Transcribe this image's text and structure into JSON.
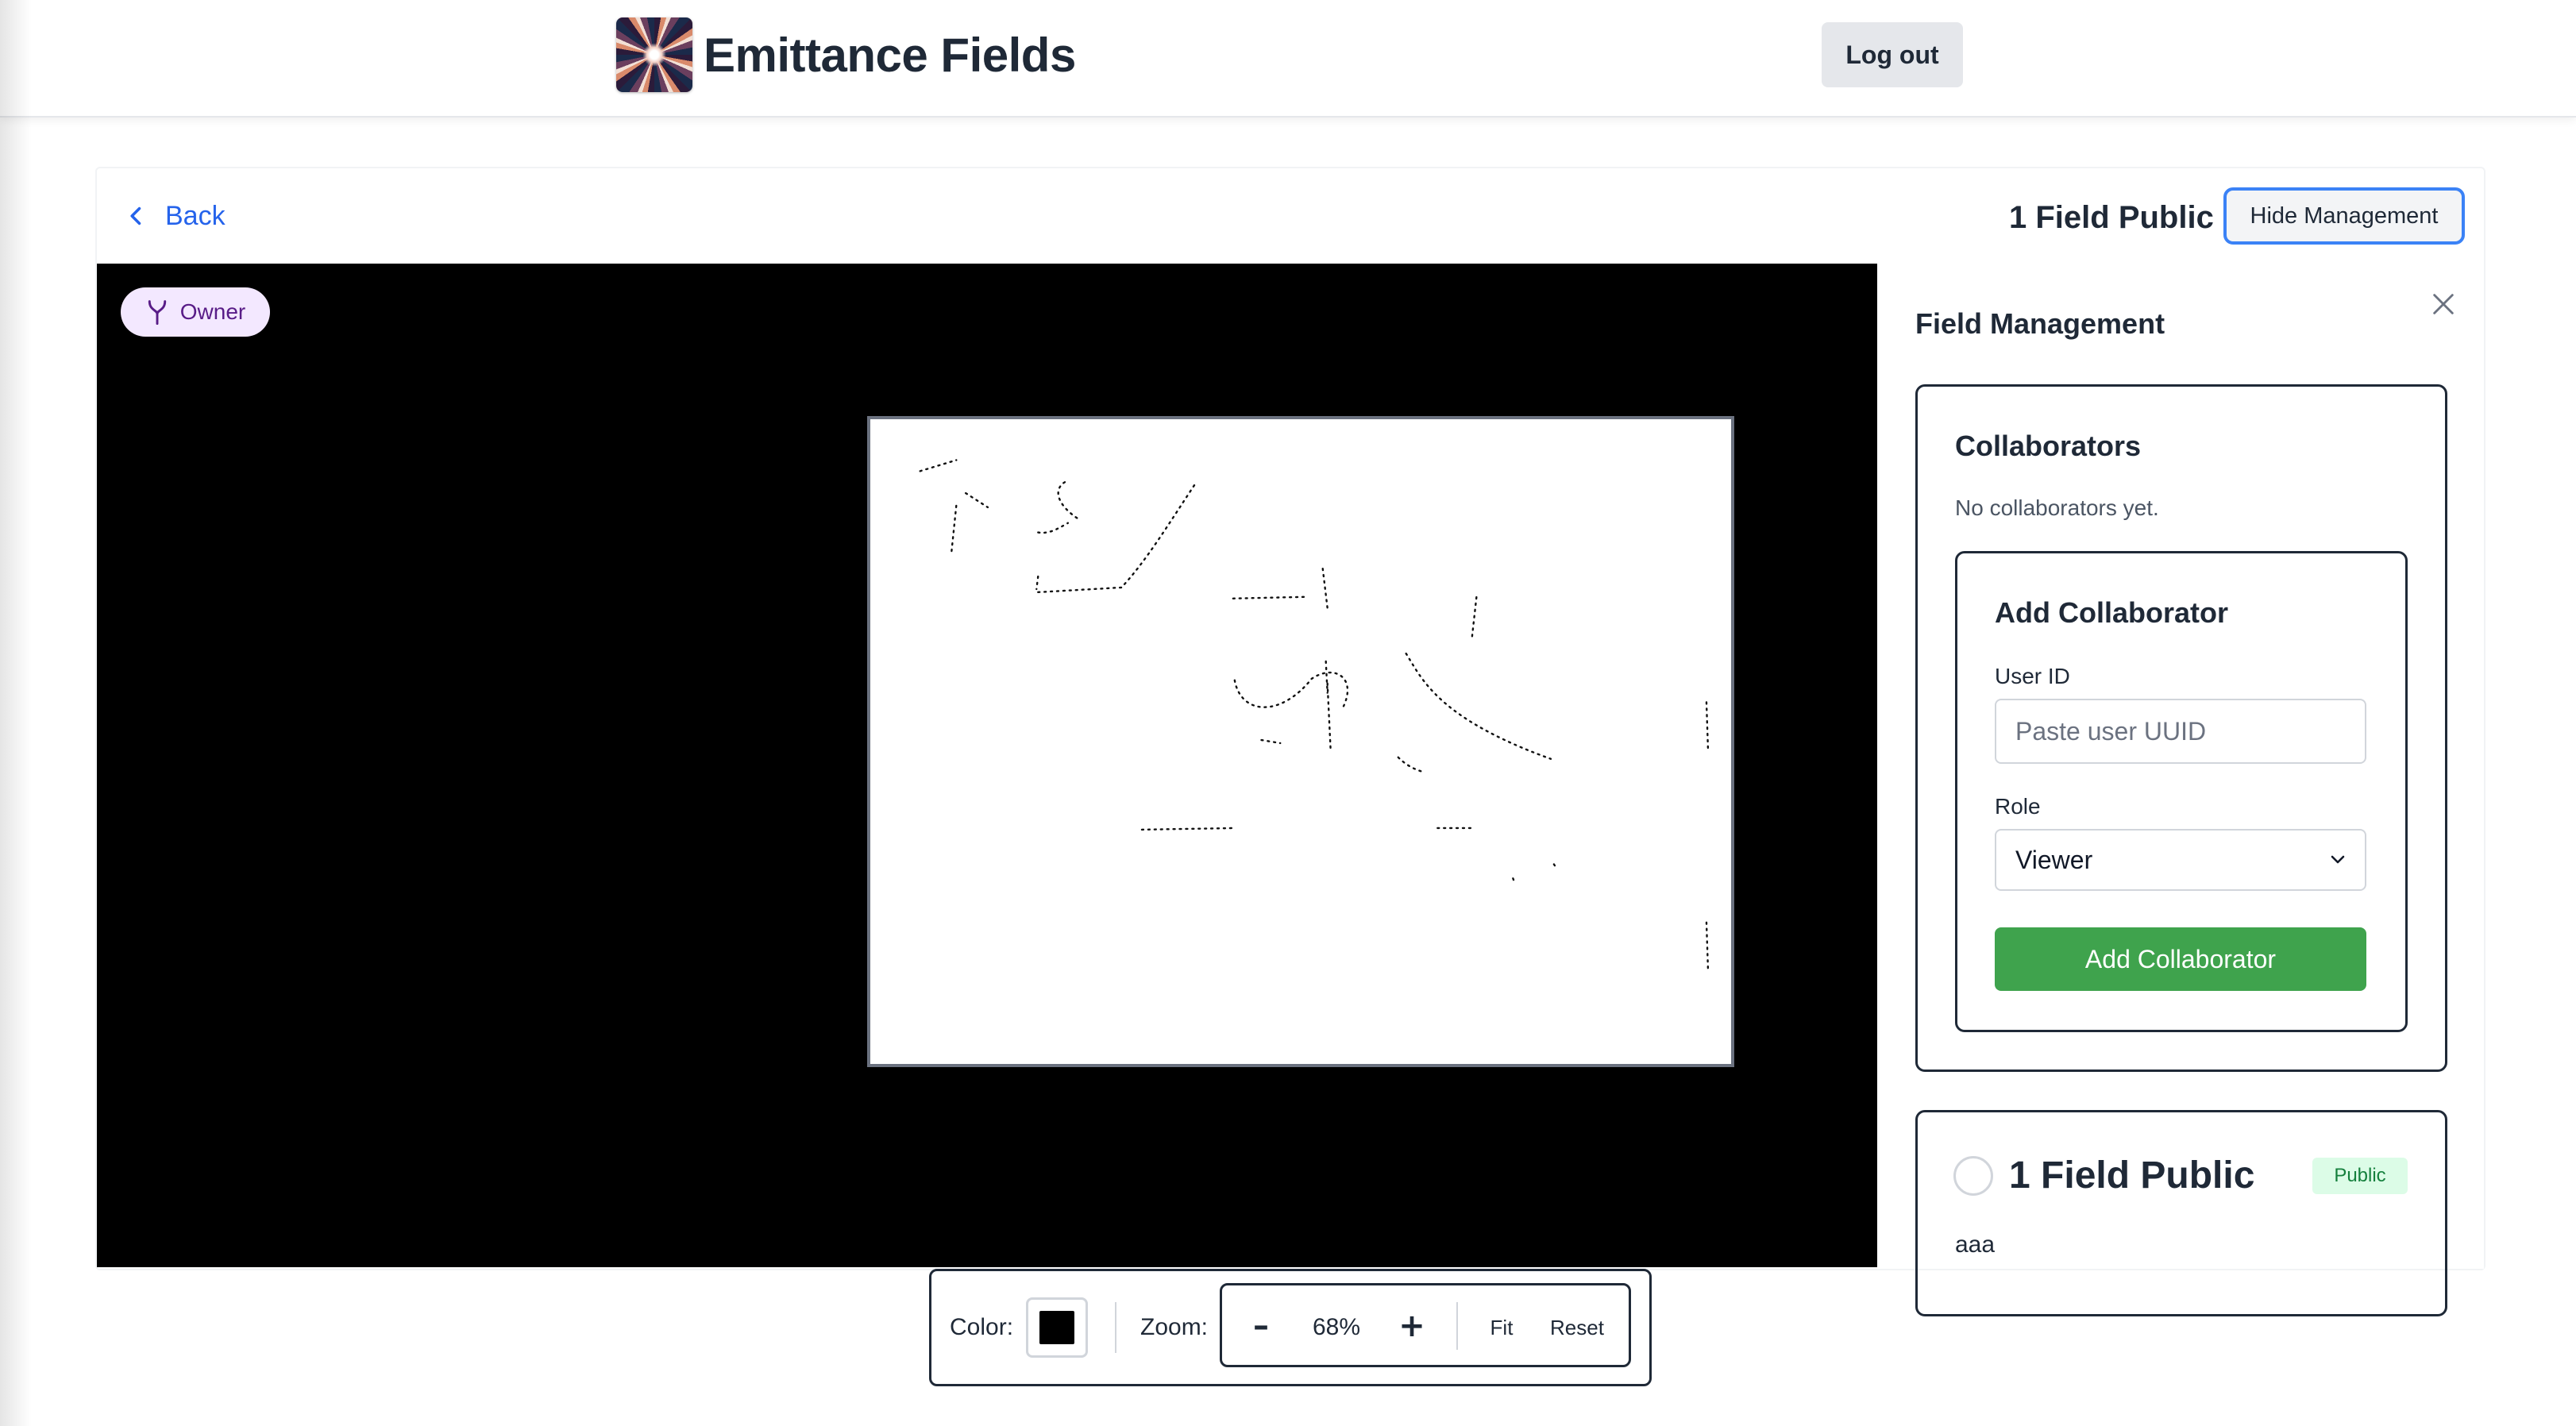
{
  "header": {
    "logo_icon": "emittance-fields-logo",
    "app_title": "Emittance Fields",
    "logout_label": "Log out"
  },
  "toolbar_top": {
    "back_label": "Back",
    "back_icon": "chevron-left-icon",
    "field_name": "1 Field Public",
    "hide_management_label": "Hide Management"
  },
  "canvas": {
    "owner_badge_label": "Owner",
    "owner_badge_icon": "fork-icon",
    "background_color": "#000000",
    "board_color": "#ffffff"
  },
  "panel": {
    "title": "Field Management",
    "close_icon": "close-icon",
    "collaborators": {
      "title": "Collaborators",
      "empty_text": "No collaborators yet.",
      "add_form": {
        "title": "Add Collaborator",
        "user_id_label": "User ID",
        "user_id_placeholder": "Paste user UUID",
        "user_id_value": "",
        "role_label": "Role",
        "role_selected": "Viewer",
        "submit_label": "Add Collaborator"
      }
    },
    "field_card": {
      "title": "1 Field Public",
      "visibility_badge": "Public",
      "description": "aaa"
    }
  },
  "bottom_toolbar": {
    "color_label": "Color:",
    "color_value": "#000000",
    "zoom_label": "Zoom:",
    "zoom_minus": "–",
    "zoom_value": "68%",
    "zoom_plus": "+",
    "fit_label": "Fit",
    "reset_label": "Reset"
  },
  "colors": {
    "link_blue": "#2563eb",
    "accent_blue": "#3b82f6",
    "add_button_green": "#3fa34d",
    "owner_badge_bg": "#f3e8ff",
    "owner_badge_text": "#581c87",
    "public_badge_bg": "#dcfce7",
    "public_badge_text": "#15803d"
  }
}
